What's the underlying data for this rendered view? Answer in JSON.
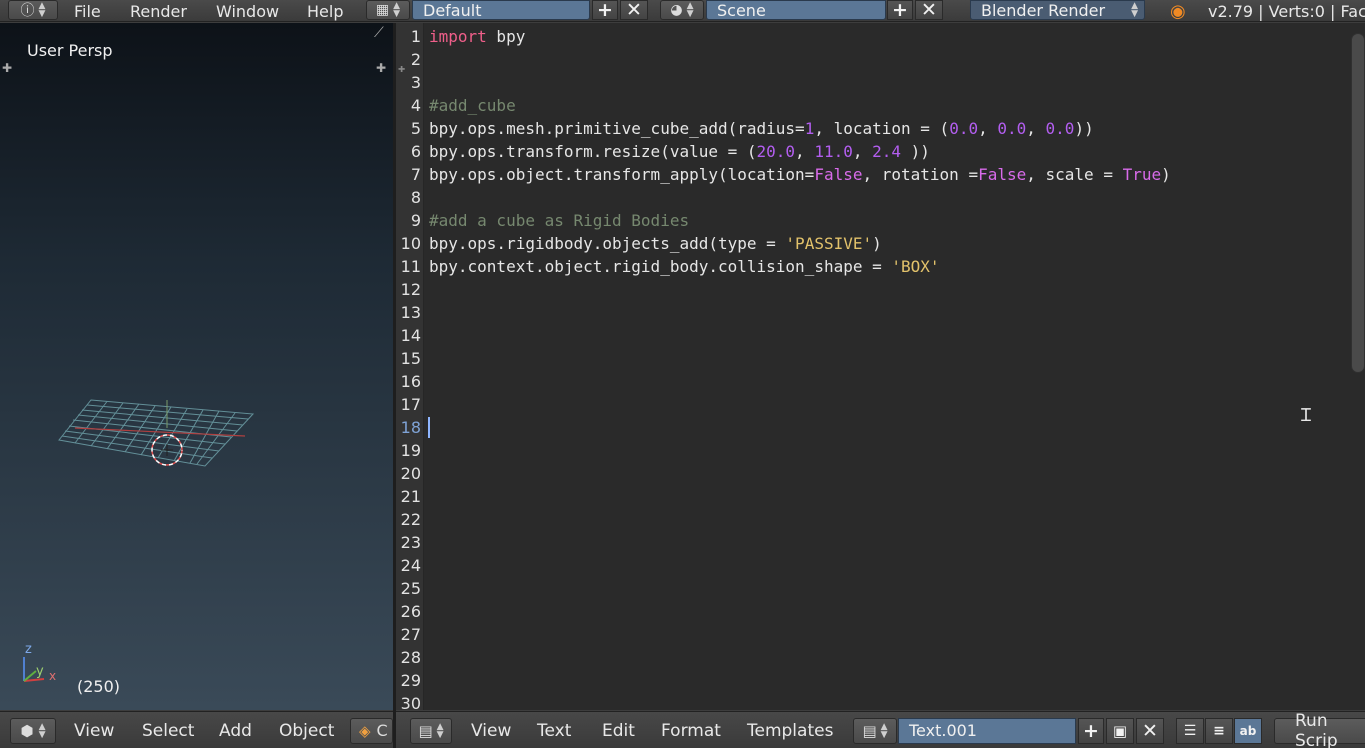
{
  "header": {
    "menus": [
      "File",
      "Render",
      "Window",
      "Help"
    ],
    "layout": "Default",
    "scene": "Scene",
    "engine": "Blender Render",
    "status": "v2.79 | Verts:0 | Fac"
  },
  "viewport": {
    "view_label": "User Persp",
    "frame_label": "(250)",
    "axis": {
      "z": "z",
      "y": "y",
      "x": "x"
    }
  },
  "viewport_bar": {
    "menus": [
      "View",
      "Select",
      "Add",
      "Object"
    ],
    "mode_partial": "C"
  },
  "text_editor": {
    "active_line": 18,
    "line_numbers": [
      "1",
      "2",
      "3",
      "4",
      "5",
      "6",
      "7",
      "8",
      "9",
      "10",
      "11",
      "12",
      "13",
      "14",
      "15",
      "16",
      "17",
      "18",
      "19",
      "20",
      "21",
      "22",
      "23",
      "24",
      "25",
      "26",
      "27",
      "28",
      "29",
      "30"
    ],
    "lines": [
      [
        [
          "kw",
          "import"
        ],
        [
          "t",
          " bpy"
        ]
      ],
      [],
      [],
      [
        [
          "cmt",
          "#add_cube"
        ]
      ],
      [
        [
          "t",
          "bpy.ops.mesh.primitive_cube_add(radius="
        ],
        [
          "num",
          "1"
        ],
        [
          "t",
          ", location = ("
        ],
        [
          "num",
          "0.0"
        ],
        [
          "t",
          ", "
        ],
        [
          "num",
          "0.0"
        ],
        [
          "t",
          ", "
        ],
        [
          "num",
          "0.0"
        ],
        [
          "t",
          "))"
        ]
      ],
      [
        [
          "t",
          "bpy.ops.transform.resize(value = ("
        ],
        [
          "num",
          "20.0"
        ],
        [
          "t",
          ", "
        ],
        [
          "num",
          "11.0"
        ],
        [
          "t",
          ", "
        ],
        [
          "num",
          "2.4"
        ],
        [
          "t",
          " ))"
        ]
      ],
      [
        [
          "t",
          "bpy.ops.object.transform_apply(location="
        ],
        [
          "bool",
          "False"
        ],
        [
          "t",
          ", rotation ="
        ],
        [
          "bool",
          "False"
        ],
        [
          "t",
          ", scale = "
        ],
        [
          "bool",
          "True"
        ],
        [
          "t",
          ")"
        ]
      ],
      [],
      [
        [
          "cmt",
          "#add a cube as Rigid Bodies"
        ]
      ],
      [
        [
          "t",
          "bpy.ops.rigidbody.objects_add(type = "
        ],
        [
          "str",
          "'PASSIVE'"
        ],
        [
          "t",
          ")"
        ]
      ],
      [
        [
          "t",
          "bpy.context.object.rigid_body.collision_shape = "
        ],
        [
          "str",
          "'BOX'"
        ]
      ]
    ]
  },
  "text_bar": {
    "menus": [
      "View",
      "Text",
      "Edit",
      "Format",
      "Templates"
    ],
    "text_name": "Text.001",
    "run_script": "Run Scrip"
  },
  "colors": {
    "keyword": "#f05f8a",
    "number": "#b35ef0",
    "string": "#e2c26b",
    "comment": "#76886f",
    "field_blue": "#5b7796"
  }
}
